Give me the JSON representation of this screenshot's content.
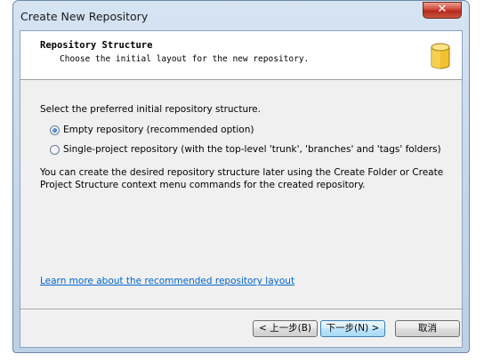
{
  "window": {
    "title": "Create New Repository",
    "close_label": "✕"
  },
  "header": {
    "title": "Repository Structure",
    "subtitle": "Choose the initial layout for the new repository.",
    "icon": "database-icon"
  },
  "content": {
    "prompt": "Select the preferred initial repository structure.",
    "options": [
      {
        "label": "Empty repository (recommended option)",
        "checked": true
      },
      {
        "label": "Single-project repository (with the top-level 'trunk', 'branches' and 'tags' folders)",
        "checked": false
      }
    ],
    "info": "You can create the desired repository structure later using the Create Folder or Create Project Structure context menu commands for the created repository.",
    "link": "Learn more about the recommended repository layout"
  },
  "buttons": {
    "back": "< 上一步(B)",
    "next": "下一步(N) >",
    "cancel": "取消"
  },
  "colors": {
    "accent_link": "#0066cc",
    "icon_fill": "#f2c12e"
  }
}
